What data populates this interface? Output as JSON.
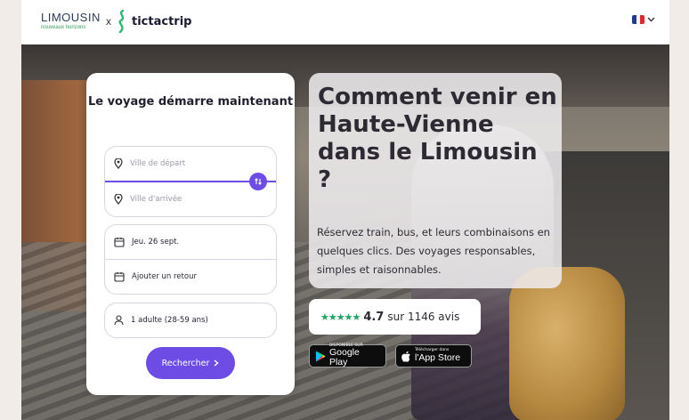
{
  "header": {
    "partner_logo": {
      "name": "LIMOUSIN",
      "tagline": "nouveaux horizons"
    },
    "separator": "x",
    "brand": "tictactrip",
    "language": {
      "icon": "france-flag-icon",
      "dropdown_icon": "chevron-down-icon",
      "flag_colors": [
        "#1f3a93",
        "#ffffff",
        "#e3262f"
      ]
    }
  },
  "search_card": {
    "title": "Le voyage démarre maintenant",
    "departure_placeholder": "Ville de départ",
    "arrival_placeholder": "Ville d'arrivée",
    "outbound_date": "Jeu. 26 sept.",
    "return_placeholder": "Ajouter un retour",
    "passengers": "1 adulte (28-59 ans)",
    "search_button": "Rechercher"
  },
  "hero": {
    "heading": "Comment venir en Haute-Vienne dans le Limousin ?",
    "description": "Réservez train, bus, et leurs combinaisons en quelques clics. Des voyages responsables, simples et raisonnables."
  },
  "rating": {
    "stars": "★★★★★",
    "stars_value": 4.7,
    "score": "4.7",
    "text": "sur 1146 avis"
  },
  "stores": {
    "google": {
      "small": "DISPONIBLE SUR",
      "big": "Google Play"
    },
    "apple": {
      "small": "Télécharger dans",
      "big": "l'App Store"
    }
  },
  "colors": {
    "accent": "#6d4ce6",
    "star": "#1fa563",
    "limousin_green": "#3aa05a",
    "tictactrip_green": "#2bb673"
  }
}
